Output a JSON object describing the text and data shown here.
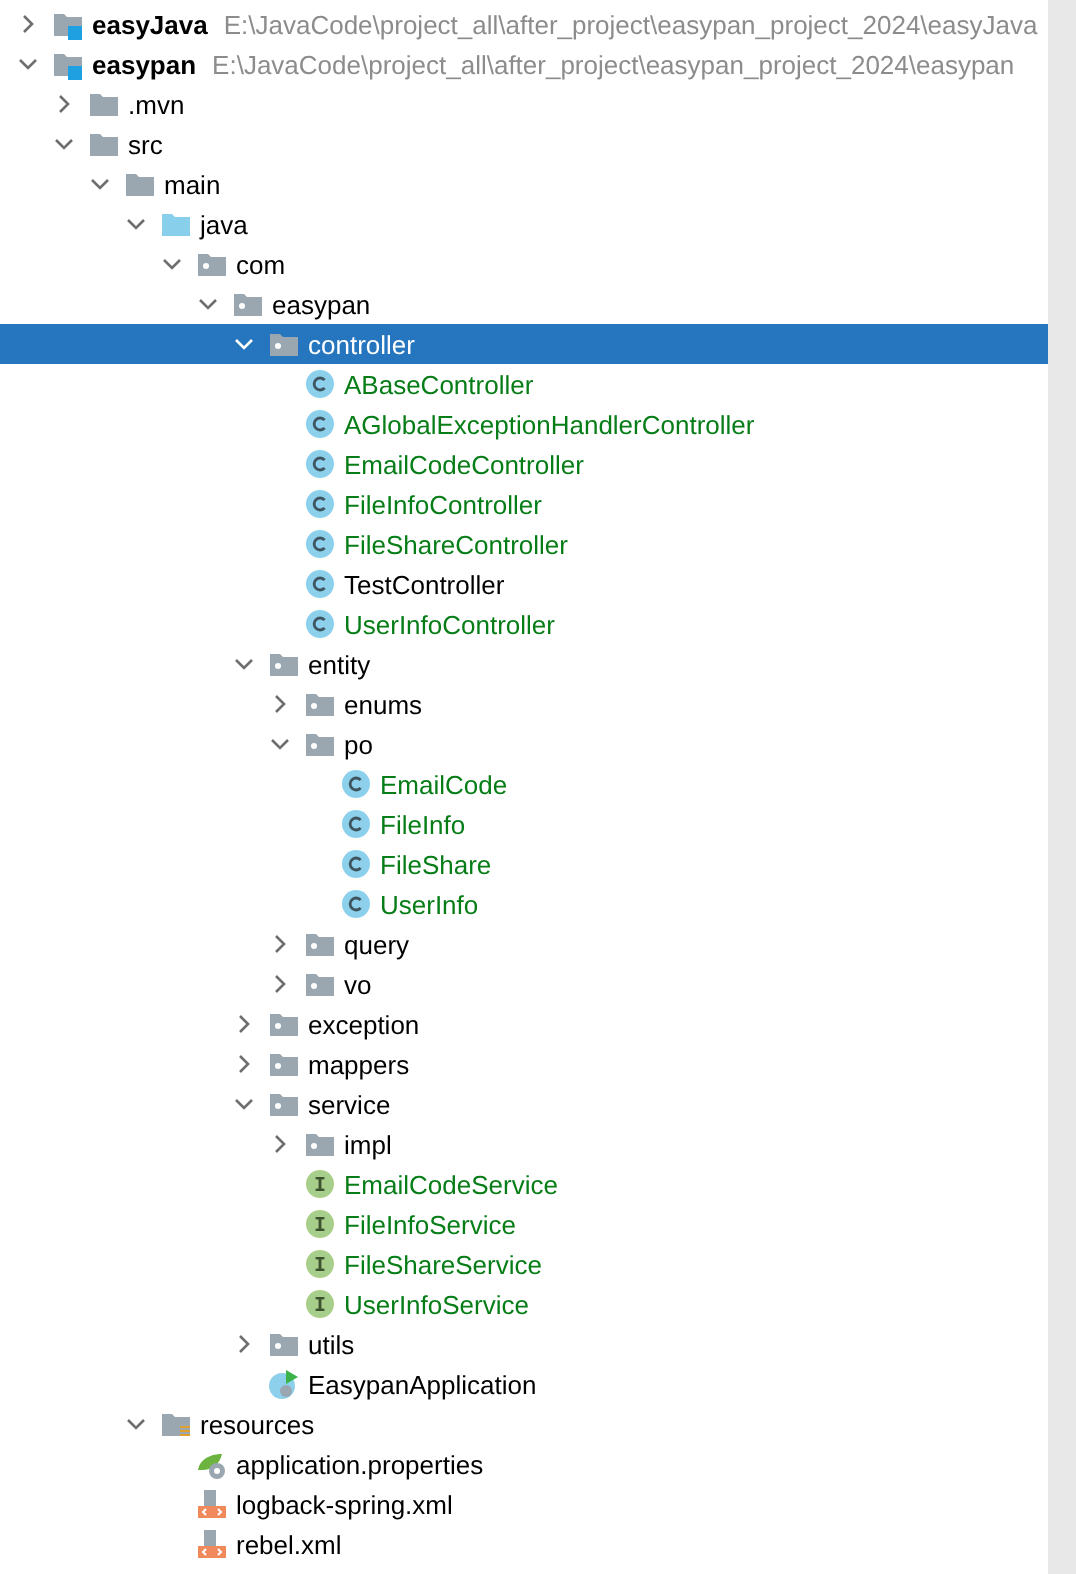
{
  "tree": [
    {
      "kind": "project",
      "label": "easyJava",
      "path": "E:\\JavaCode\\project_all\\after_project\\easypan_project_2024\\easyJava",
      "expanded": false,
      "selected": false
    },
    {
      "kind": "project",
      "label": "easypan",
      "path": "E:\\JavaCode\\project_all\\after_project\\easypan_project_2024\\easypan",
      "expanded": true,
      "selected": false,
      "children": [
        {
          "kind": "folder",
          "label": ".mvn",
          "expanded": false,
          "selected": false
        },
        {
          "kind": "folder",
          "label": "src",
          "expanded": true,
          "selected": false,
          "children": [
            {
              "kind": "folder",
              "label": "main",
              "expanded": true,
              "selected": false,
              "children": [
                {
                  "kind": "source",
                  "label": "java",
                  "expanded": true,
                  "selected": false,
                  "children": [
                    {
                      "kind": "package",
                      "label": "com",
                      "expanded": true,
                      "selected": false,
                      "children": [
                        {
                          "kind": "package",
                          "label": "easypan",
                          "expanded": true,
                          "selected": false,
                          "children": [
                            {
                              "kind": "package",
                              "label": "controller",
                              "expanded": true,
                              "selected": true,
                              "children": [
                                {
                                  "kind": "class",
                                  "label": "ABaseController",
                                  "vcs_added": true,
                                  "selected": false
                                },
                                {
                                  "kind": "class",
                                  "label": "AGlobalExceptionHandlerController",
                                  "vcs_added": true,
                                  "selected": false
                                },
                                {
                                  "kind": "class",
                                  "label": "EmailCodeController",
                                  "vcs_added": true,
                                  "selected": false
                                },
                                {
                                  "kind": "class",
                                  "label": "FileInfoController",
                                  "vcs_added": true,
                                  "selected": false
                                },
                                {
                                  "kind": "class",
                                  "label": "FileShareController",
                                  "vcs_added": true,
                                  "selected": false
                                },
                                {
                                  "kind": "class",
                                  "label": "TestController",
                                  "vcs_added": false,
                                  "selected": false
                                },
                                {
                                  "kind": "class",
                                  "label": "UserInfoController",
                                  "vcs_added": true,
                                  "selected": false
                                }
                              ]
                            },
                            {
                              "kind": "package",
                              "label": "entity",
                              "expanded": true,
                              "selected": false,
                              "children": [
                                {
                                  "kind": "package",
                                  "label": "enums",
                                  "expanded": false,
                                  "selected": false
                                },
                                {
                                  "kind": "package",
                                  "label": "po",
                                  "expanded": true,
                                  "selected": false,
                                  "children": [
                                    {
                                      "kind": "class",
                                      "label": "EmailCode",
                                      "vcs_added": true,
                                      "selected": false
                                    },
                                    {
                                      "kind": "class",
                                      "label": "FileInfo",
                                      "vcs_added": true,
                                      "selected": false
                                    },
                                    {
                                      "kind": "class",
                                      "label": "FileShare",
                                      "vcs_added": true,
                                      "selected": false
                                    },
                                    {
                                      "kind": "class",
                                      "label": "UserInfo",
                                      "vcs_added": true,
                                      "selected": false
                                    }
                                  ]
                                },
                                {
                                  "kind": "package",
                                  "label": "query",
                                  "expanded": false,
                                  "selected": false
                                },
                                {
                                  "kind": "package",
                                  "label": "vo",
                                  "expanded": false,
                                  "selected": false
                                }
                              ]
                            },
                            {
                              "kind": "package",
                              "label": "exception",
                              "expanded": false,
                              "selected": false
                            },
                            {
                              "kind": "package",
                              "label": "mappers",
                              "expanded": false,
                              "selected": false
                            },
                            {
                              "kind": "package",
                              "label": "service",
                              "expanded": true,
                              "selected": false,
                              "children": [
                                {
                                  "kind": "package",
                                  "label": "impl",
                                  "expanded": false,
                                  "selected": false
                                },
                                {
                                  "kind": "interface",
                                  "label": "EmailCodeService",
                                  "vcs_added": true,
                                  "selected": false
                                },
                                {
                                  "kind": "interface",
                                  "label": "FileInfoService",
                                  "vcs_added": true,
                                  "selected": false
                                },
                                {
                                  "kind": "interface",
                                  "label": "FileShareService",
                                  "vcs_added": true,
                                  "selected": false
                                },
                                {
                                  "kind": "interface",
                                  "label": "UserInfoService",
                                  "vcs_added": true,
                                  "selected": false
                                }
                              ]
                            },
                            {
                              "kind": "package",
                              "label": "utils",
                              "expanded": false,
                              "selected": false
                            },
                            {
                              "kind": "app",
                              "label": "EasypanApplication",
                              "vcs_added": false,
                              "selected": false
                            }
                          ]
                        }
                      ]
                    }
                  ]
                },
                {
                  "kind": "resources",
                  "label": "resources",
                  "expanded": true,
                  "selected": false,
                  "children": [
                    {
                      "kind": "properties",
                      "label": "application.properties",
                      "vcs_added": false,
                      "selected": false
                    },
                    {
                      "kind": "xml",
                      "label": "logback-spring.xml",
                      "vcs_added": false,
                      "selected": false
                    },
                    {
                      "kind": "xml",
                      "label": "rebel.xml",
                      "vcs_added": false,
                      "selected": false
                    }
                  ]
                }
              ]
            }
          ]
        }
      ]
    }
  ]
}
